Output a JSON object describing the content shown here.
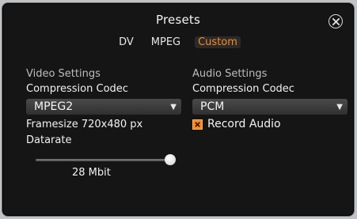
{
  "dialog": {
    "title": "Presets",
    "tabs": [
      "DV",
      "MPEG",
      "Custom"
    ],
    "active_tab": "Custom"
  },
  "video": {
    "section": "Video Settings",
    "codec_label": "Compression Codec",
    "codec_value": "MPEG2",
    "framesize": "Framesize 720x480 px",
    "datarate_label": "Datarate",
    "datarate_value": "28 Mbit",
    "datarate_level": 1.0
  },
  "audio": {
    "section": "Audio Settings",
    "codec_label": "Compression Codec",
    "codec_value": "PCM",
    "record_audio_label": "Record Audio",
    "record_audio_checked": true
  },
  "icons": {
    "close": "close-icon",
    "dropdown": "chevron-down-icon",
    "check": "x-mark-icon"
  },
  "colors": {
    "accent": "#ff8a1e",
    "background": "#151515",
    "text": "#f2f2f2"
  }
}
